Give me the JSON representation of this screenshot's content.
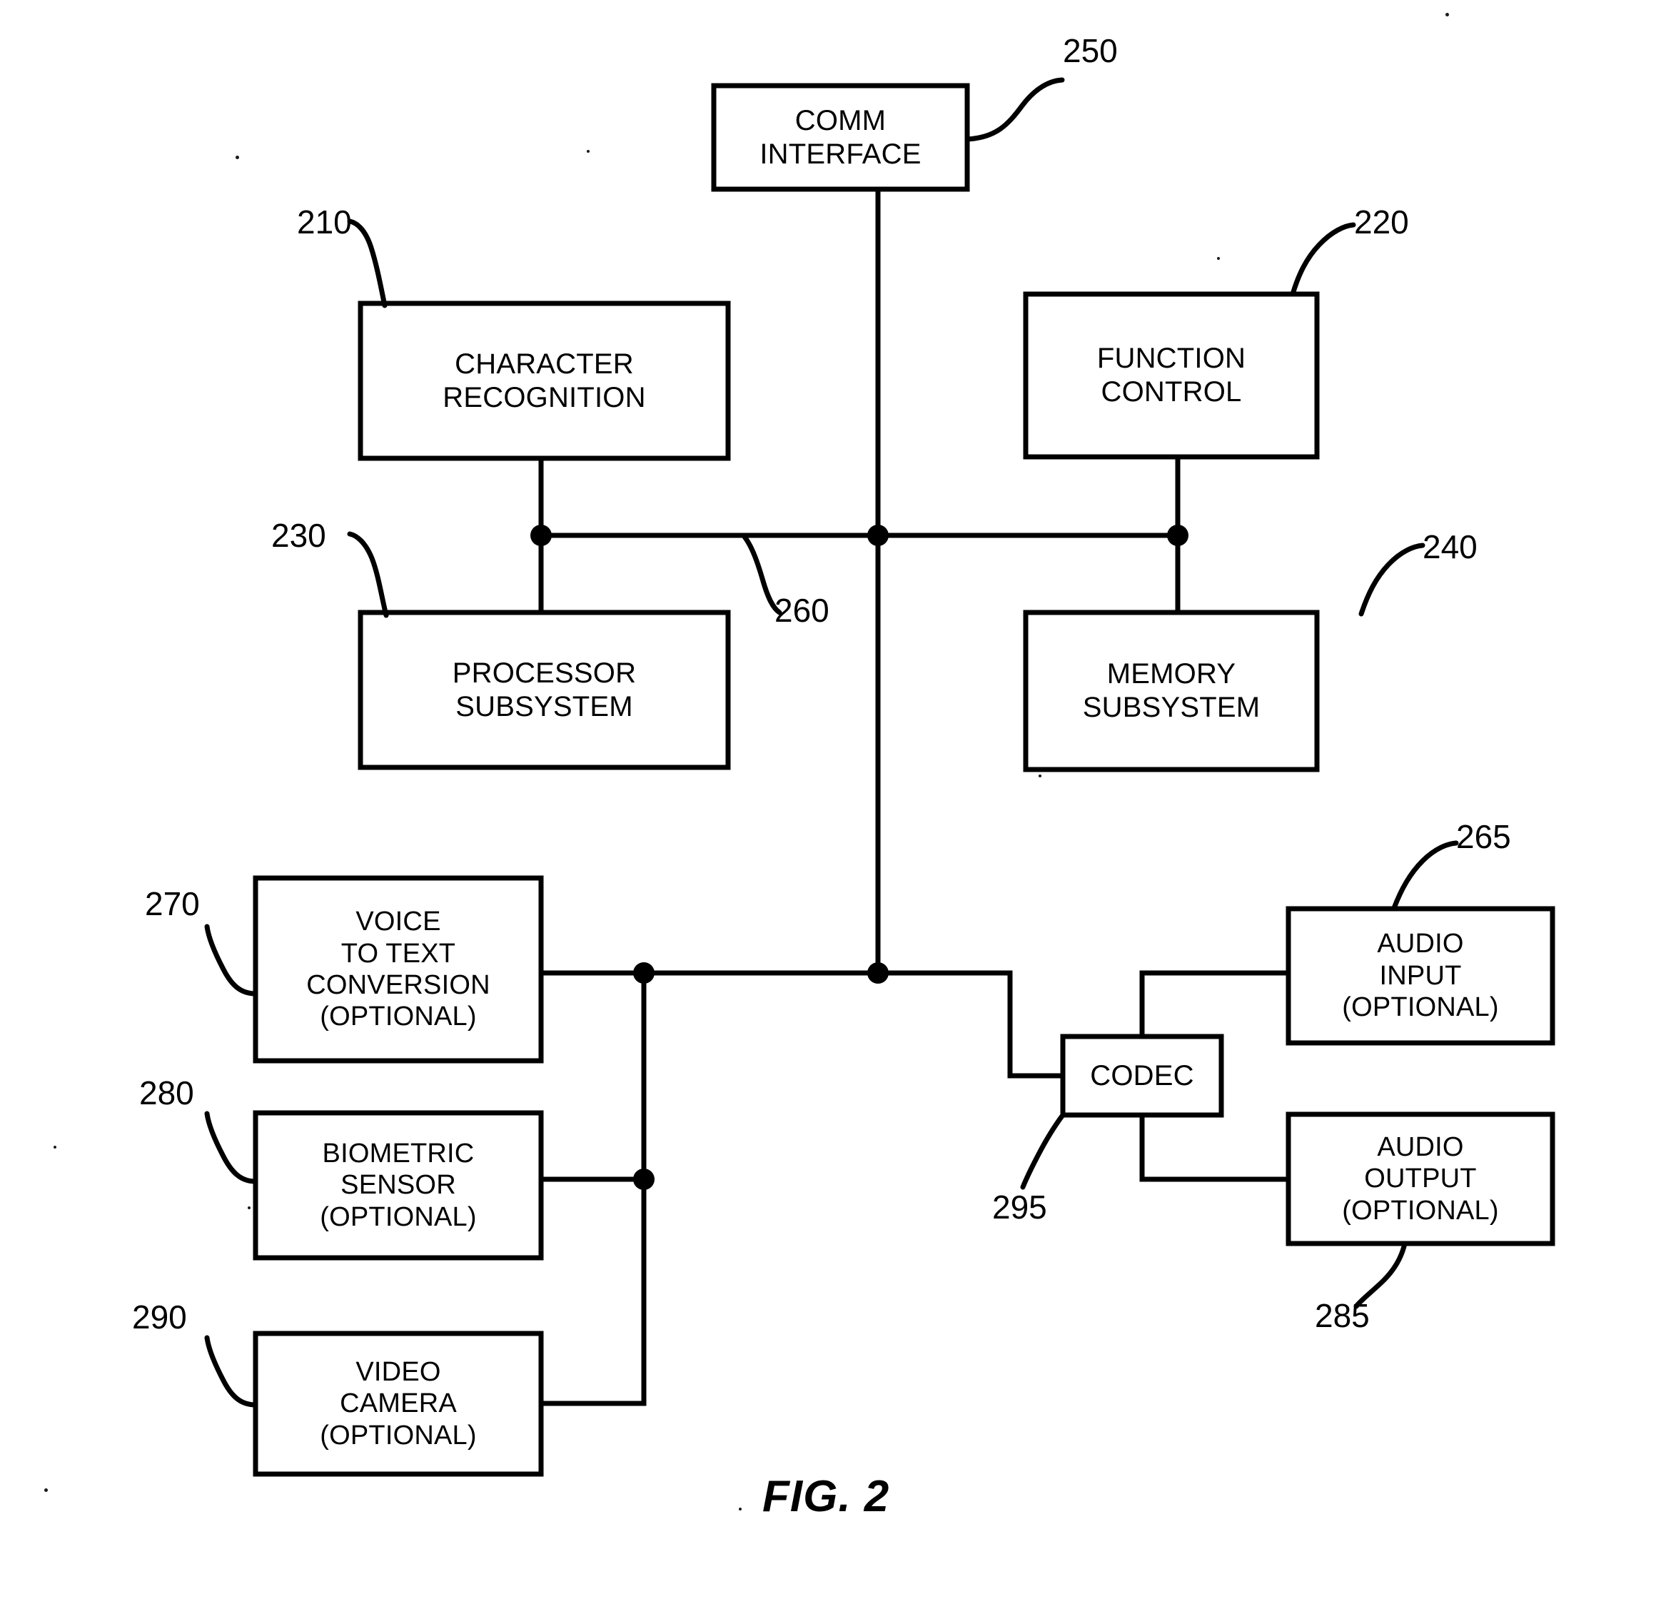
{
  "figure": {
    "caption": "FIG. 2",
    "title": "FIG. 2"
  },
  "blocks": {
    "comm_interface": {
      "ref": "250",
      "line1": "COMM",
      "line2": "INTERFACE"
    },
    "character_recognition": {
      "ref": "210",
      "line1": "CHARACTER",
      "line2": "RECOGNITION"
    },
    "function_control": {
      "ref": "220",
      "line1": "FUNCTION",
      "line2": "CONTROL"
    },
    "processor_subsystem": {
      "ref": "230",
      "line1": "PROCESSOR",
      "line2": "SUBSYSTEM"
    },
    "memory_subsystem": {
      "ref": "240",
      "line1": "MEMORY",
      "line2": "SUBSYSTEM"
    },
    "voice_to_text": {
      "ref": "270",
      "line1": "VOICE",
      "line2": "TO TEXT",
      "line3": "CONVERSION",
      "line4": "(OPTIONAL)"
    },
    "biometric_sensor": {
      "ref": "280",
      "line1": "BIOMETRIC",
      "line2": "SENSOR",
      "line3": "(OPTIONAL)"
    },
    "video_camera": {
      "ref": "290",
      "line1": "VIDEO",
      "line2": "CAMERA",
      "line3": "(OPTIONAL)"
    },
    "audio_input": {
      "ref": "265",
      "line1": "AUDIO",
      "line2": "INPUT",
      "line3": "(OPTIONAL)"
    },
    "audio_output": {
      "ref": "285",
      "line1": "AUDIO",
      "line2": "OUTPUT",
      "line3": "(OPTIONAL)"
    },
    "codec": {
      "ref": "295",
      "line1": "CODEC"
    }
  },
  "bus": {
    "ref": "260"
  },
  "colors": {
    "ink": "#000000",
    "paper": "#ffffff"
  }
}
